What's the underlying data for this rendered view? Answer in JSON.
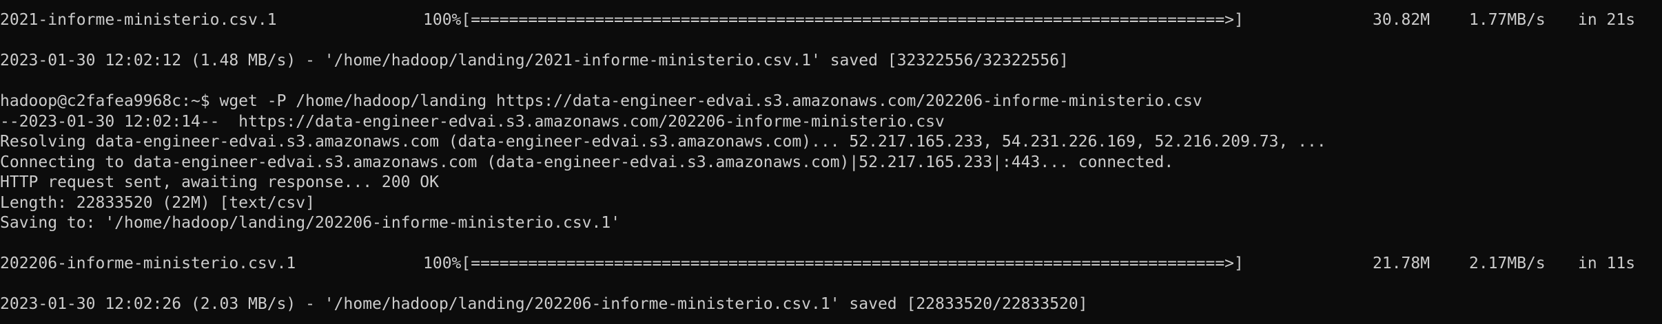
{
  "terminal": {
    "lines": [
      {
        "kind": "progress",
        "file": "2021-informe-ministerio.csv.1",
        "bar": "100%[===============================================================================>]",
        "size": "30.82M",
        "rate": "1.77MB/s",
        "time": "in 21s"
      },
      {
        "kind": "blank",
        "text": ""
      },
      {
        "kind": "text",
        "text": "2023-01-30 12:02:12 (1.48 MB/s) - '/home/hadoop/landing/2021-informe-ministerio.csv.1' saved [32322556/32322556]"
      },
      {
        "kind": "blank",
        "text": ""
      },
      {
        "kind": "prompt",
        "text": "hadoop@c2fafea9968c:~$ wget -P /home/hadoop/landing https://data-engineer-edvai.s3.amazonaws.com/202206-informe-ministerio.csv"
      },
      {
        "kind": "text",
        "text": "--2023-01-30 12:02:14--  https://data-engineer-edvai.s3.amazonaws.com/202206-informe-ministerio.csv"
      },
      {
        "kind": "text",
        "text": "Resolving data-engineer-edvai.s3.amazonaws.com (data-engineer-edvai.s3.amazonaws.com)... 52.217.165.233, 54.231.226.169, 52.216.209.73, ..."
      },
      {
        "kind": "text",
        "text": "Connecting to data-engineer-edvai.s3.amazonaws.com (data-engineer-edvai.s3.amazonaws.com)|52.217.165.233|:443... connected."
      },
      {
        "kind": "text",
        "text": "HTTP request sent, awaiting response... 200 OK"
      },
      {
        "kind": "text",
        "text": "Length: 22833520 (22M) [text/csv]"
      },
      {
        "kind": "text",
        "text": "Saving to: '/home/hadoop/landing/202206-informe-ministerio.csv.1'"
      },
      {
        "kind": "blank",
        "text": ""
      },
      {
        "kind": "progress",
        "file": "202206-informe-ministerio.csv.1",
        "bar": "100%[===============================================================================>]",
        "size": "21.78M",
        "rate": "2.17MB/s",
        "time": "in 11s"
      },
      {
        "kind": "blank",
        "text": ""
      },
      {
        "kind": "text",
        "text": "2023-01-30 12:02:26 (2.03 MB/s) - '/home/hadoop/landing/202206-informe-ministerio.csv.1' saved [22833520/22833520]"
      }
    ]
  }
}
